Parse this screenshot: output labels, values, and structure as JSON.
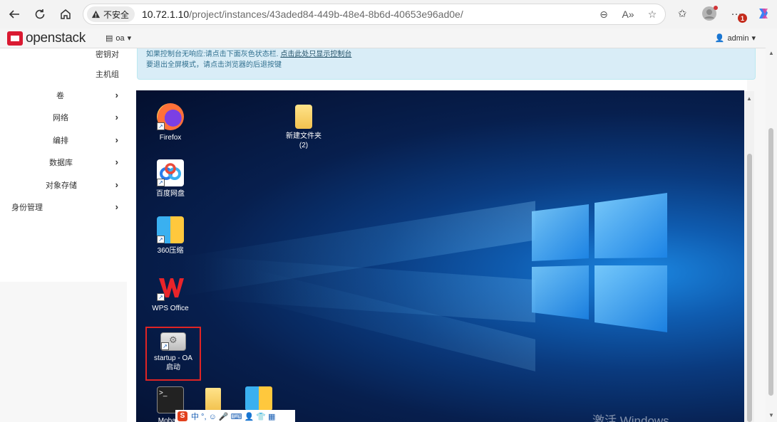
{
  "browser": {
    "security_label": "不安全",
    "url_host": "10.72.1.10",
    "url_path": "/project/instances/43aded84-449b-48e4-8b6d-40653e96ad0e/",
    "notification_count": "1"
  },
  "header": {
    "logo_text": "openstack",
    "project": "oa",
    "user": "admin"
  },
  "sidebar": {
    "sub_items": [
      "密钥对",
      "主机组"
    ],
    "items": [
      {
        "label": "卷"
      },
      {
        "label": "网络"
      },
      {
        "label": "编排"
      },
      {
        "label": "数据库"
      },
      {
        "label": "对象存储"
      },
      {
        "label": "身份管理"
      }
    ]
  },
  "info": {
    "line1_prefix": "如果控制台无响应:请点击下面灰色状态栏.",
    "line1_link": "点击此处只显示控制台",
    "line2": "要退出全屏模式，请点击浏览器的后退按键"
  },
  "desktop": {
    "icons": [
      {
        "label": "Firefox"
      },
      {
        "label": "新建文件夹\n(2)"
      },
      {
        "label": "百度网盘"
      },
      {
        "label": "360压缩"
      },
      {
        "label": "WPS Office"
      },
      {
        "label": "startup - OA\n启动"
      },
      {
        "label": "MobaXt"
      }
    ],
    "watermark": "激活 Windows",
    "ime_text": "中 °, ☺ 🎤 ⌨ 👤 👕 ▦"
  },
  "colors": {
    "brand": "#da1a32",
    "info_bg": "#d9edf7",
    "selection": "#e02424"
  }
}
